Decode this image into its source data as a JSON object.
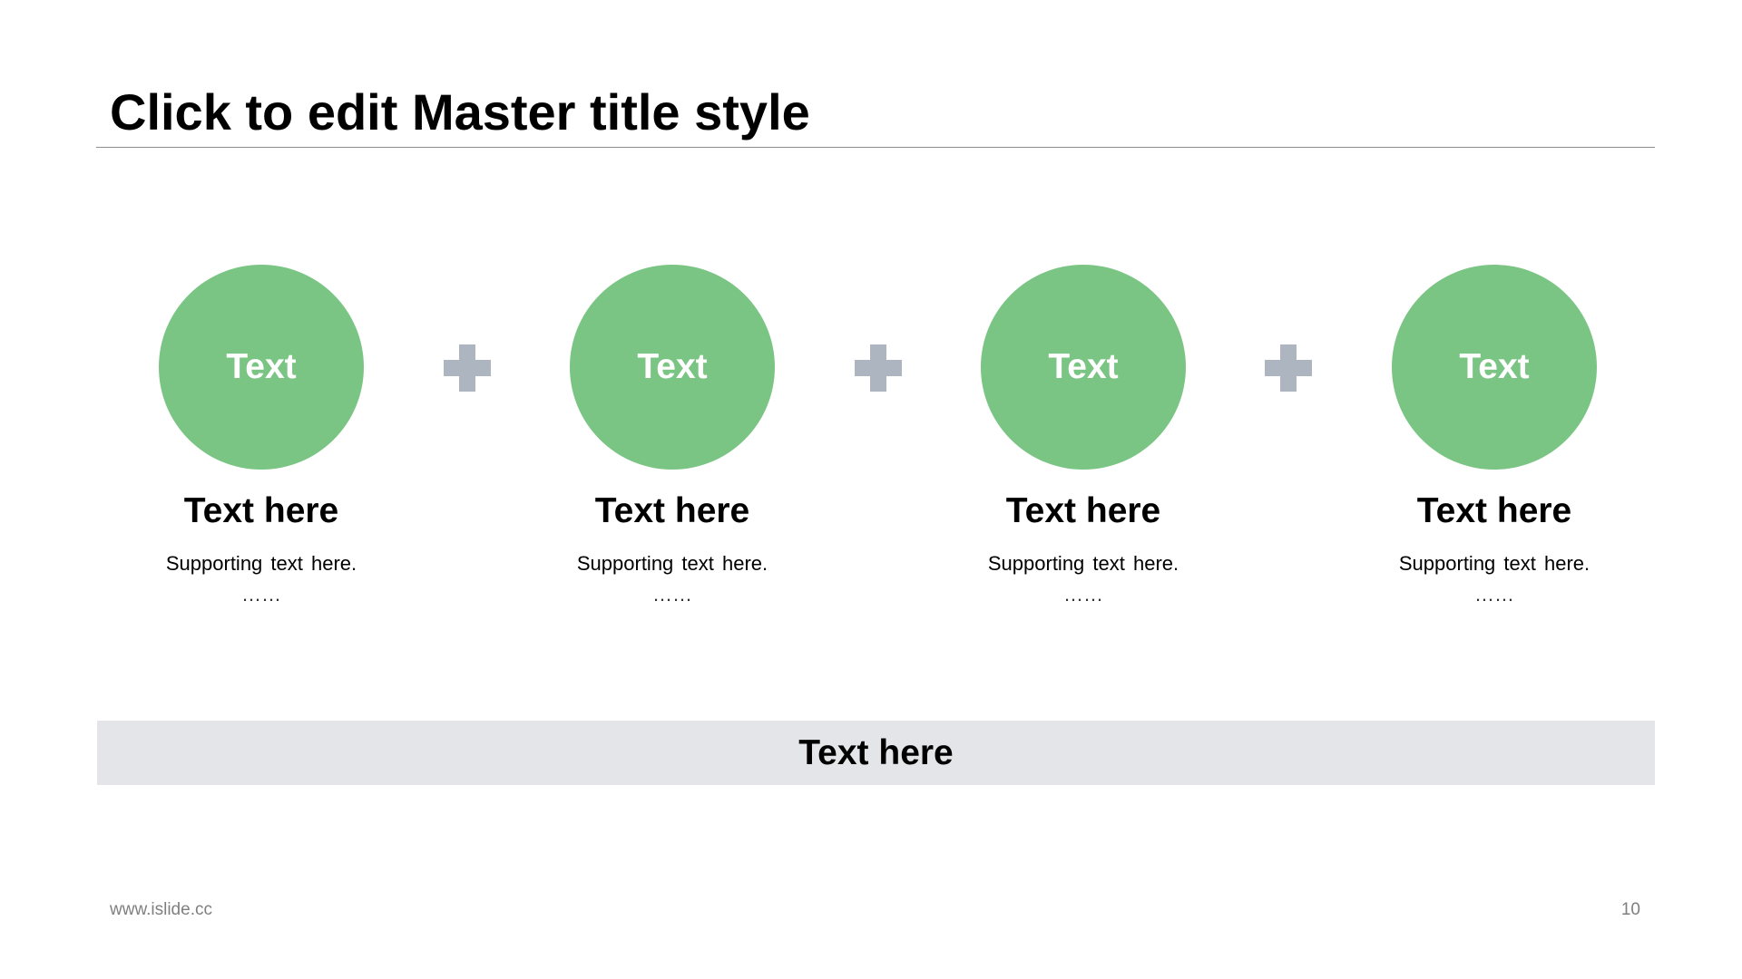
{
  "title": "Click to edit Master title style",
  "colors": {
    "circle_fill": "#7bc584",
    "plus_fill": "#adb5c0",
    "summary_bar_fill": "#e4e5e8"
  },
  "steps": [
    {
      "circle_label": "Text",
      "heading": "Text here",
      "support": "Supporting text here.",
      "ellipsis": "……"
    },
    {
      "circle_label": "Text",
      "heading": "Text here",
      "support": "Supporting text here.",
      "ellipsis": "……"
    },
    {
      "circle_label": "Text",
      "heading": "Text here",
      "support": "Supporting text here.",
      "ellipsis": "……"
    },
    {
      "circle_label": "Text",
      "heading": "Text here",
      "support": "Supporting text here.",
      "ellipsis": "……"
    }
  ],
  "connectors": [
    {
      "icon": "plus-icon"
    },
    {
      "icon": "plus-icon"
    },
    {
      "icon": "plus-icon"
    }
  ],
  "summary": "Text here",
  "footer": {
    "website": "www.islide.cc",
    "page_number": "10"
  }
}
